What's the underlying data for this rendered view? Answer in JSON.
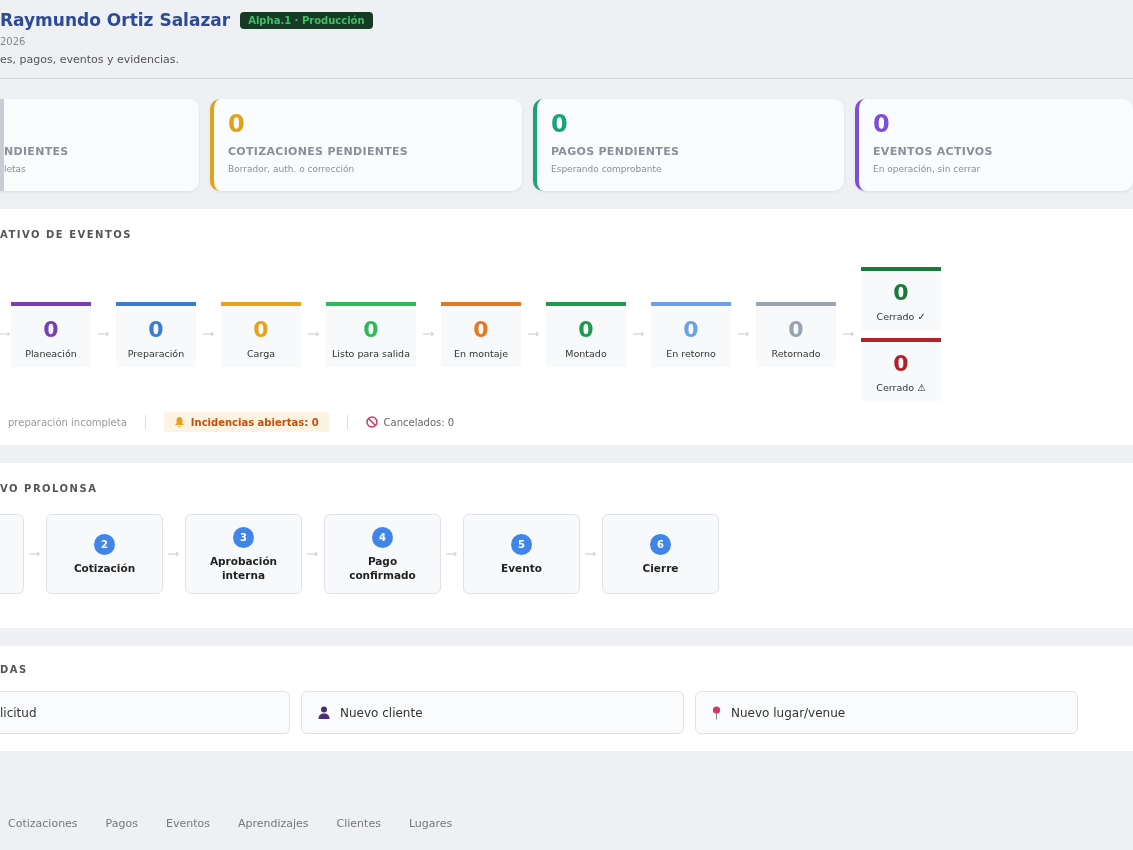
{
  "header": {
    "title": "Raymundo Ortiz Salazar",
    "badge": "Alpha.1 · Producción",
    "date": "2026",
    "subtitle": "es, pagos, eventos y evidencias."
  },
  "stats": [
    {
      "label": "NDIENTES",
      "note": "letas",
      "color": "#c9ccd2"
    },
    {
      "value": "0",
      "label": "COTIZACIONES PENDIENTES",
      "note": "Borrador, auth. o corrección",
      "color": "#e0a21a"
    },
    {
      "value": "0",
      "label": "PAGOS PENDIENTES",
      "note": "Esperando comprobante",
      "color": "#1aa37a"
    },
    {
      "value": "0",
      "label": "EVENTOS ACTIVOS",
      "note": "En operación, sin cerrar",
      "color": "#7c4dd6"
    }
  ],
  "pipeline": {
    "title": "ATIVO DE EVENTOS",
    "stages": [
      {
        "count": "0",
        "label": "Planeación",
        "color": "#7a3fb0"
      },
      {
        "count": "0",
        "label": "Preparación",
        "color": "#3a7bd5"
      },
      {
        "count": "0",
        "label": "Carga",
        "color": "#e8a21a"
      },
      {
        "count": "0",
        "label": "Listo para salida",
        "color": "#2dbb5a"
      },
      {
        "count": "0",
        "label": "En montaje",
        "color": "#e8781f"
      },
      {
        "count": "0",
        "label": "Montado",
        "color": "#1f9a4c"
      },
      {
        "count": "0",
        "label": "En retorno",
        "color": "#6aa2e6"
      },
      {
        "count": "0",
        "label": "Retornado",
        "color": "#9aa3b0"
      }
    ],
    "closed": [
      {
        "count": "0",
        "label": "Cerrado ✓",
        "color": "#1a7a3c"
      },
      {
        "count": "0",
        "label": "Cerrado ⚠",
        "color": "#b0222a"
      }
    ],
    "footer": [
      {
        "kind": "plain",
        "text": "preparación incompleta"
      },
      {
        "kind": "alert",
        "text": "Incidencias abiertas: 0"
      },
      {
        "kind": "cancel",
        "text": "Cancelados: 0"
      }
    ]
  },
  "flow": {
    "title": "VO PROLONSA",
    "steps": [
      {
        "number": "2",
        "label": "Cotización"
      },
      {
        "number": "3",
        "label": "Aprobación interna"
      },
      {
        "number": "4",
        "label": "Pago confirmado"
      },
      {
        "number": "5",
        "label": "Evento"
      },
      {
        "number": "6",
        "label": "Cierre"
      }
    ]
  },
  "quick": {
    "title": "DAS",
    "actions": [
      {
        "kind": "plain",
        "label": "licitud"
      },
      {
        "kind": "client",
        "label": "Nuevo cliente"
      },
      {
        "kind": "venue",
        "label": "Nuevo lugar/venue"
      }
    ]
  },
  "nav": [
    {
      "label": "Cotizaciones",
      "selected": false
    },
    {
      "label": "Pagos",
      "selected": false
    },
    {
      "label": "Eventos",
      "selected": false
    },
    {
      "label": "Aprendizajes",
      "selected": false
    },
    {
      "label": "Clientes",
      "selected": false
    },
    {
      "label": "Lugares",
      "selected": false
    }
  ]
}
